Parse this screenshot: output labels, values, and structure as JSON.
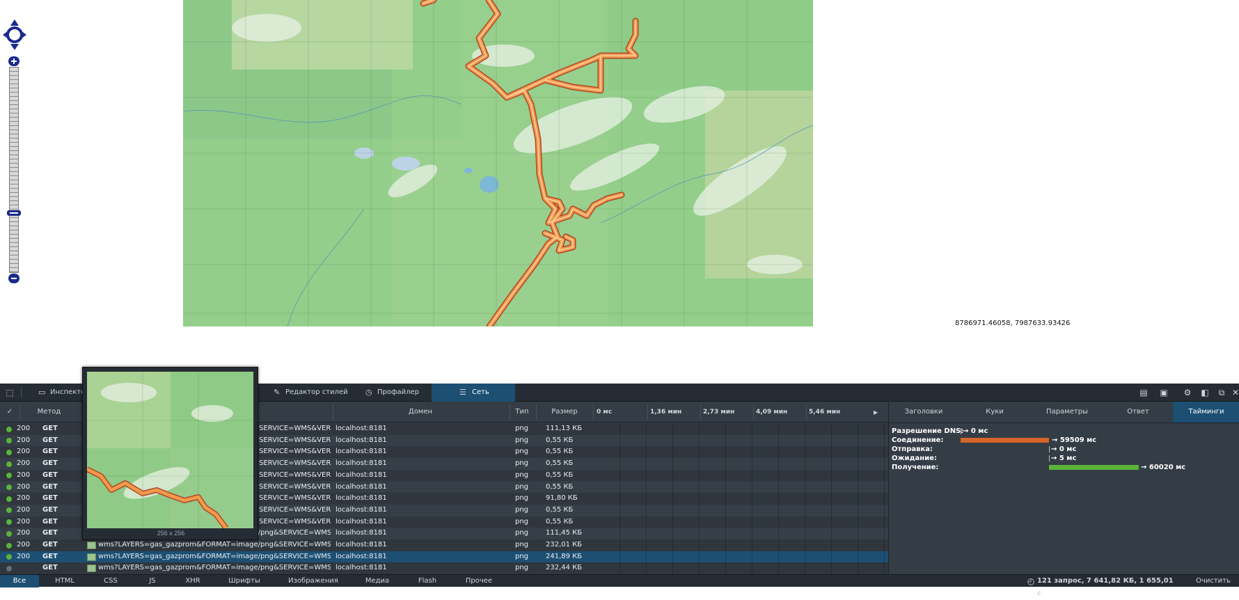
{
  "map": {
    "mouse_position": "8786971.46058, 7987633.93426"
  },
  "devtools": {
    "tabs": [
      {
        "label": "Инспекто",
        "icon": "inspector-icon"
      },
      {
        "label": "Редактор стилей",
        "icon": "style-editor-icon"
      },
      {
        "label": "Профайлер",
        "icon": "profiler-icon"
      },
      {
        "label": "Сеть",
        "icon": "network-icon"
      }
    ],
    "active_tab": "Сеть",
    "columns": {
      "check": "✓",
      "method": "Метод",
      "domain": "Домен",
      "type": "Тип",
      "size": "Размер"
    },
    "timeline_ticks": [
      "0 мс",
      "1,36 мин",
      "2,73 мин",
      "4,09 мин",
      "5,46 мин"
    ],
    "rows": [
      {
        "status": "200",
        "method": "GET",
        "file": "SERVICE=WMS&VER...",
        "domain": "localhost:8181",
        "type": "png",
        "size": "111,13 КБ"
      },
      {
        "status": "200",
        "method": "GET",
        "file": "SERVICE=WMS&VER...",
        "domain": "localhost:8181",
        "type": "png",
        "size": "0,55 КБ"
      },
      {
        "status": "200",
        "method": "GET",
        "file": "SERVICE=WMS&VER...",
        "domain": "localhost:8181",
        "type": "png",
        "size": "0,55 КБ"
      },
      {
        "status": "200",
        "method": "GET",
        "file": "SERVICE=WMS&VER...",
        "domain": "localhost:8181",
        "type": "png",
        "size": "0,55 КБ"
      },
      {
        "status": "200",
        "method": "GET",
        "file": "SERVICE=WMS&VER...",
        "domain": "localhost:8181",
        "type": "png",
        "size": "0,55 КБ"
      },
      {
        "status": "200",
        "method": "GET",
        "file": "SERVICE=WMS&VER...",
        "domain": "localhost:8181",
        "type": "png",
        "size": "0,55 КБ"
      },
      {
        "status": "200",
        "method": "GET",
        "file": "SERVICE=WMS&VER...",
        "domain": "localhost:8181",
        "type": "png",
        "size": "91,80 КБ"
      },
      {
        "status": "200",
        "method": "GET",
        "file": "SERVICE=WMS&VER...",
        "domain": "localhost:8181",
        "type": "png",
        "size": "0,55 КБ"
      },
      {
        "status": "200",
        "method": "GET",
        "file": "SERVICE=WMS&VER...",
        "domain": "localhost:8181",
        "type": "png",
        "size": "0,55 КБ"
      },
      {
        "status": "200",
        "method": "GET",
        "file": "wms?LAYERS=gas_gazprom&FORMAT=image/png&SERVICE=WMS&VER...",
        "domain": "localhost:8181",
        "type": "png",
        "size": "111,45 КБ"
      },
      {
        "status": "200",
        "method": "GET",
        "file": "wms?LAYERS=gas_gazprom&FORMAT=image/png&SERVICE=WMS&VER...",
        "domain": "localhost:8181",
        "type": "png",
        "size": "232,01 КБ"
      },
      {
        "status": "200",
        "method": "GET",
        "file": "wms?LAYERS=gas_gazprom&FORMAT=image/png&SERVICE=WMS&VER...",
        "domain": "localhost:8181",
        "type": "png",
        "size": "241,89 КБ"
      },
      {
        "status": "",
        "method": "GET",
        "file": "wms?LAYERS=gas_gazprom&FORMAT=image/png&SERVICE=WMS&VER...",
        "domain": "localhost:8181",
        "type": "png",
        "size": "232,44 КБ"
      }
    ],
    "preview": {
      "dimensions": "256 x 256"
    },
    "side_tabs": [
      "Заголовки",
      "Куки",
      "Параметры",
      "Ответ",
      "Тайминги"
    ],
    "active_side_tab": "Тайминги",
    "timings": [
      {
        "label": "Разрешение DNS:",
        "value": "→ 0 мс"
      },
      {
        "label": "Соединение:",
        "value": "→ 59509 мс",
        "color": "#d5652a"
      },
      {
        "label": "Отправка:",
        "value": "→ 0 мс"
      },
      {
        "label": "Ожидание:",
        "value": "→ 5 мс"
      },
      {
        "label": "Получение:",
        "value": "→ 60020 мс",
        "color": "#5bb33b"
      }
    ],
    "filters": [
      "Все",
      "HTML",
      "CSS",
      "JS",
      "XHR",
      "Шрифты",
      "Изображения",
      "Медиа",
      "Flash",
      "Прочее"
    ],
    "active_filter": "Все",
    "summary": "121 запрос, 7 641,82 КБ, 1 655,01 с",
    "clear_label": "Очистить"
  }
}
